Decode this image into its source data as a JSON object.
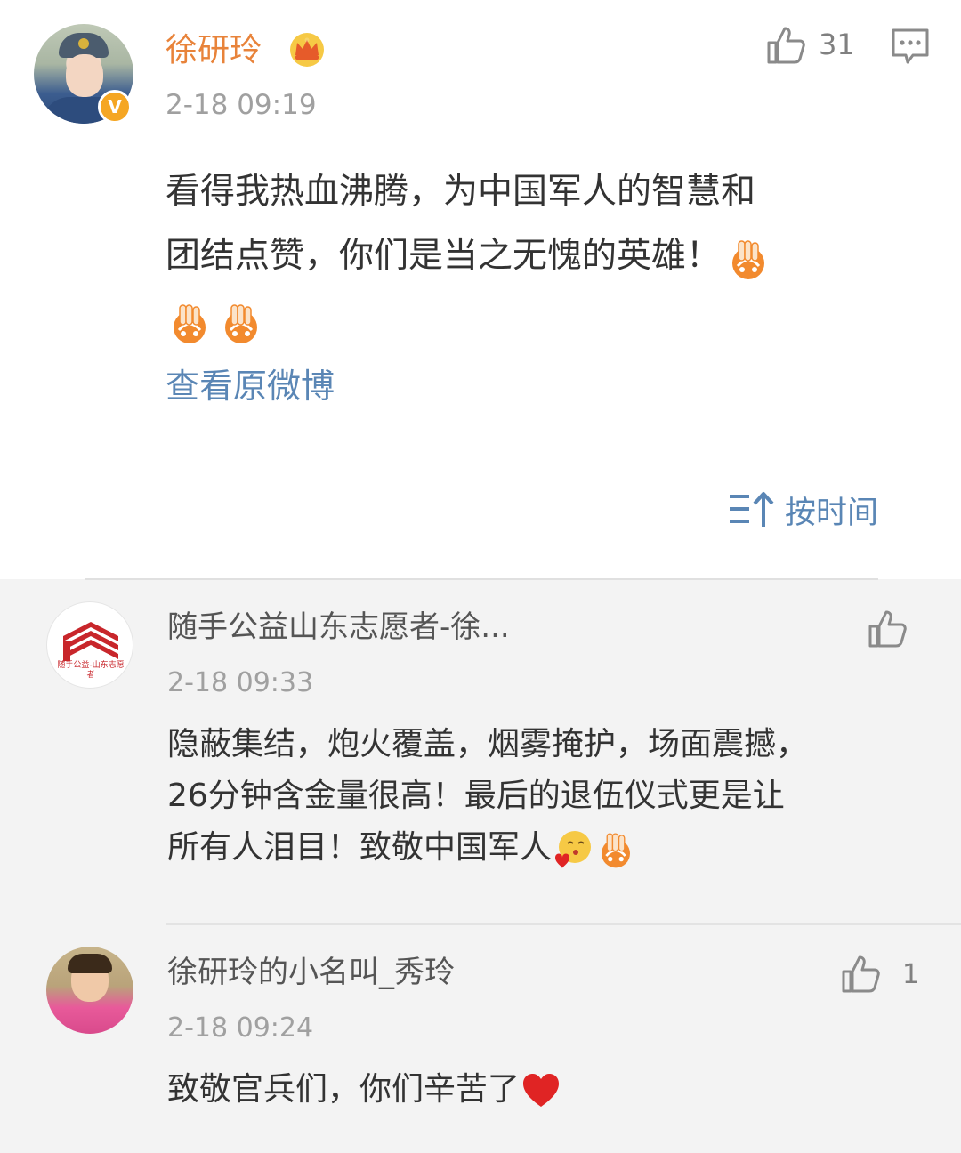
{
  "post": {
    "username": "徐研玲",
    "timestamp": "2-18 09:19",
    "like_count": "31",
    "content_line1": "看得我热血沸腾，为中国军人的智慧和",
    "content_line2": "团结点赞，你们是当之无愧的英雄！",
    "view_original": "查看原微博",
    "sort_label": "按时间",
    "icons": [
      "crown-icon",
      "verified-icon",
      "thumbs-up-icon",
      "comment-icon",
      "sort-time-icon",
      "peace-hands-emoji"
    ]
  },
  "replies": [
    {
      "username": "随手公益山东志愿者-徐...",
      "avatar_text": "随手公益-山东志愿者",
      "timestamp": "2-18 09:33",
      "like_count": "",
      "text_line1": "隐蔽集结，炮火覆盖，烟雾掩护，场面震撼，",
      "text_line2": "26分钟含金量很高！最后的退伍仪式更是让",
      "text_line3": "所有人泪目！致敬中国军人"
    },
    {
      "username": "徐研玲的小名叫_秀玲",
      "timestamp": "2-18 09:24",
      "like_count": "1",
      "text_line1": "致敬官兵们，你们辛苦了"
    }
  ],
  "colors": {
    "username_accent": "#e8833a",
    "link_blue": "#5a86b5",
    "timestamp_gray": "#a0a0a0",
    "reply_bg": "#f3f3f3",
    "verified_badge": "#f5a623",
    "heart_red": "#e02424"
  }
}
